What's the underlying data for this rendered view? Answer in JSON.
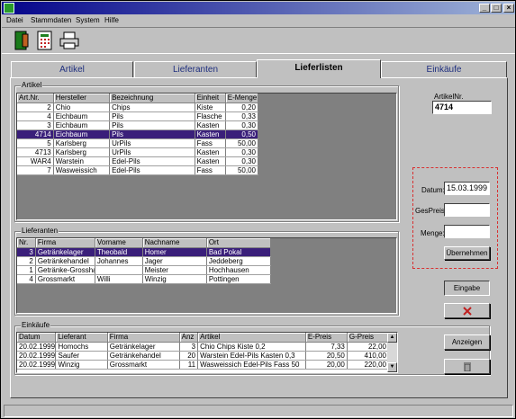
{
  "menu": {
    "items": [
      "Datei",
      "Stammdaten",
      "System",
      "Hilfe"
    ]
  },
  "window": {
    "min": "_",
    "max": "□",
    "close": "×"
  },
  "tabs": [
    "Artikel",
    "Lieferanten",
    "Lieferlisten",
    "Einkäufe"
  ],
  "artikel": {
    "group_label": "Artikel",
    "columns": [
      "Art.Nr.",
      "Hersteller",
      "Bezeichnung",
      "Einheit",
      "E-Menge"
    ],
    "rows": [
      [
        "2",
        "Chio",
        "Chips",
        "Kiste",
        "0,20"
      ],
      [
        "4",
        "Eichbaum",
        "Pils",
        "Flasche",
        "0,33"
      ],
      [
        "3",
        "Eichbaum",
        "Pils",
        "Kasten",
        "0,30"
      ],
      [
        "4714",
        "Eichbaum",
        "Pils",
        "Kasten",
        "0,50"
      ],
      [
        "5",
        "Karlsberg",
        "UrPils",
        "Fass",
        "50,00"
      ],
      [
        "4713",
        "Karlsberg",
        "UrPils",
        "Kasten",
        "0,30"
      ],
      [
        "WAR4",
        "Warstein",
        "Edel-Pils",
        "Kasten",
        "0,30"
      ],
      [
        "7",
        "Wasweissich",
        "Edel-Pils",
        "Fass",
        "50,00"
      ]
    ],
    "selected_index": 3
  },
  "artnr": {
    "label": "ArtikelNr.",
    "value": "4714"
  },
  "lieferanten": {
    "group_label": "Lieferanten",
    "columns": [
      "Nr.",
      "Firma",
      "Vorname",
      "Nachname",
      "Ort"
    ],
    "rows": [
      [
        "3",
        "Getränkelager",
        "Theobald",
        "Homer",
        "Bad Pokal"
      ],
      [
        "2",
        "Getränkehandel",
        "Johannes",
        "Jager",
        "Jeddeberg"
      ],
      [
        "1",
        "Getränke-Grosshar",
        "",
        "Meister",
        "Hochhausen"
      ],
      [
        "4",
        "Grossmarkt",
        "Willi",
        "Winzig",
        "Pottingen"
      ]
    ],
    "selected_index": 0
  },
  "form": {
    "datum_label": "Datum:",
    "datum_value": "15.03.1999",
    "gespreis_label": "GesPreis:",
    "gespreis_value": "",
    "menge_label": "Menge:",
    "menge_value": "",
    "uebernehmen": "Übernehmen"
  },
  "eingabe_button": "Eingabe",
  "einkaeufe": {
    "group_label": "Einkäufe",
    "columns": [
      "Datum",
      "Lieferant",
      "Firma",
      "Anz",
      "Artikel",
      "E-Preis",
      "G-Preis"
    ],
    "rows": [
      [
        "20.02.1999",
        "Homochs",
        "Getränkelager",
        "3",
        "Chio Chips Kiste 0,2",
        "7,33",
        "22,00"
      ],
      [
        "20.02.1999",
        "Saufer",
        "Getränkehandel",
        "20",
        "Warstein Edel-Pils Kasten 0,3",
        "20,50",
        "410,00"
      ],
      [
        "20.02.1999",
        "Winzig",
        "Grossmarkt",
        "11",
        "Wasweissich Edel-Pils Fass 50",
        "20,00",
        "220,00"
      ]
    ]
  },
  "anzeigen_button": "Anzeigen",
  "colors": {
    "selection": "#3a1f7a",
    "titlebar": "#04048a"
  }
}
